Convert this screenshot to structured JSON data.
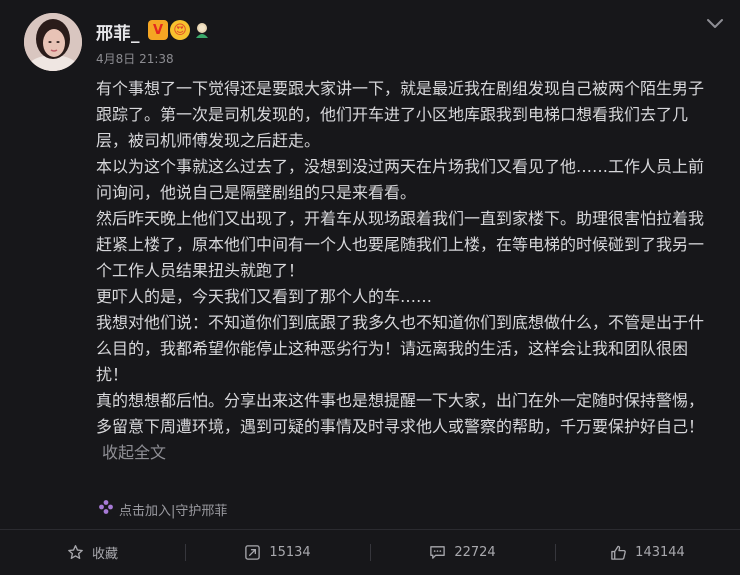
{
  "post": {
    "username": "邢菲_",
    "timestamp": "4月8日 21:38",
    "paragraphs": [
      "有个事想了一下觉得还是要跟大家讲一下，就是最近我在剧组发现自己被两个陌生男子跟踪了。第一次是司机发现的，他们开车进了小区地库跟我到电梯口想看我们去了几层，被司机师傅发现之后赶走。",
      "本以为这个事就这么过去了，没想到没过两天在片场我们又看见了他……工作人员上前问询问，他说自己是隔壁剧组的只是来看看。",
      "然后昨天晚上他们又出现了，开着车从现场跟着我们一直到家楼下。助理很害怕拉着我赶紧上楼了，原本他们中间有一个人也要尾随我们上楼，在等电梯的时候碰到了我另一个工作人员结果扭头就跑了！",
      "更吓人的是，今天我们又看到了那个人的车……",
      "我想对他们说：不知道你们到底跟了我多久也不知道你们到底想做什么，不管是出于什么目的，我都希望你能停止这种恶劣行为！请远离我的生活，这样会让我和团队很困扰！",
      "真的想想都后怕。分享出来这件事也是想提醒一下大家，出门在外一定随时保持警惕，多留意下周遭环境，遇到可疑的事情及时寻求他人或警察的帮助，千万要保护好自己！"
    ],
    "collapse_label": "收起全文",
    "super_topic": "点击加入|守护邢菲"
  },
  "badges": {
    "verified": "V",
    "vip": "😍"
  },
  "actions": {
    "favorite": "收藏",
    "repost": "15134",
    "comment": "22724",
    "like": "143144"
  },
  "colors": {
    "background": "#17171a",
    "text": "#d7d7da",
    "muted": "#8c8c91",
    "verified_badge": "#f5a623"
  },
  "icons": [
    "avatar",
    "verified-badge",
    "vip-badge",
    "fan-badge",
    "chevron-down-icon",
    "super-topic-icon",
    "star-icon",
    "repost-icon",
    "comment-icon",
    "like-icon"
  ]
}
